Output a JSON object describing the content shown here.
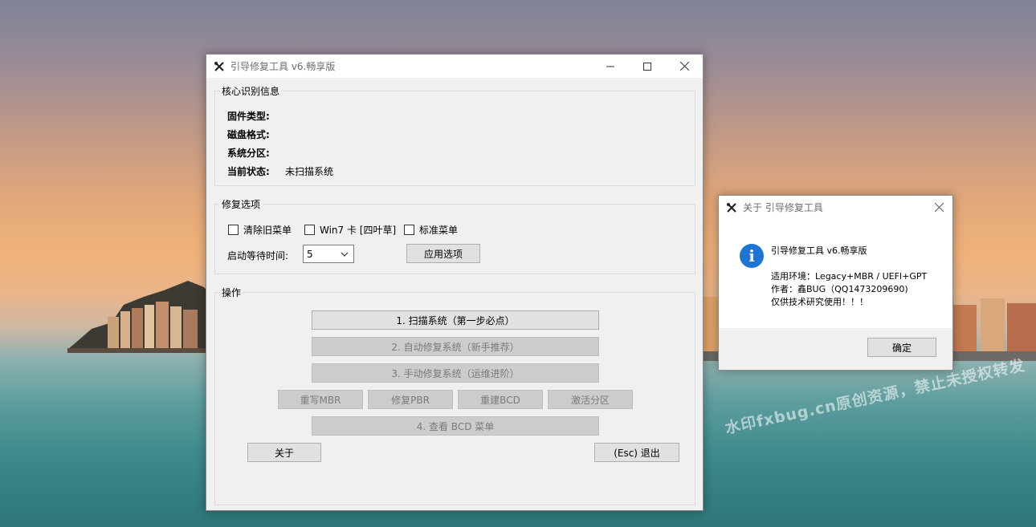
{
  "watermark": "水印fxbug.cn原创资源，禁止未授权转发",
  "main_window": {
    "title": "引导修复工具 v6.畅享版",
    "core_info": {
      "group_label": "核心识别信息",
      "rows": [
        {
          "label": "固件类型:",
          "value": ""
        },
        {
          "label": "磁盘格式:",
          "value": ""
        },
        {
          "label": "系统分区:",
          "value": ""
        },
        {
          "label": "当前状态:",
          "value": "未扫描系统"
        }
      ]
    },
    "repair_options": {
      "group_label": "修复选项",
      "checkboxes": [
        {
          "label": "清除旧菜单",
          "checked": false
        },
        {
          "label": "Win7 卡 [四叶草]",
          "checked": false
        },
        {
          "label": "标准菜单",
          "checked": false
        }
      ],
      "timeout_label": "启动等待时间:",
      "timeout_value": "5",
      "apply_button": "应用选项"
    },
    "operations": {
      "group_label": "操作",
      "scan_button": "1. 扫描系统（第一步必点）",
      "auto_repair_button": "2. 自动修复系统（新手推荐）",
      "manual_repair_button": "3. 手动修复系统（运维进阶）",
      "rewrite_mbr_button": "重写MBR",
      "repair_pbr_button": "修复PBR",
      "rebuild_bcd_button": "重建BCD",
      "activate_partition_button": "激活分区",
      "view_bcd_button": "4. 查看 BCD 菜单",
      "about_button": "关于",
      "exit_button": "(Esc) 退出"
    }
  },
  "about_dialog": {
    "title": "关于 引导修复工具",
    "line1": "引导修复工具 v6.畅享版",
    "line2": "适用环境：Legacy+MBR / UEFI+GPT",
    "line3": "作者：鑫BUG（QQ1473209690)",
    "line4": "仅供技术研究使用！！！",
    "ok_button": "确定"
  },
  "colors": {
    "info_icon": "#1e74d4",
    "focus_border": "#0078d7"
  }
}
